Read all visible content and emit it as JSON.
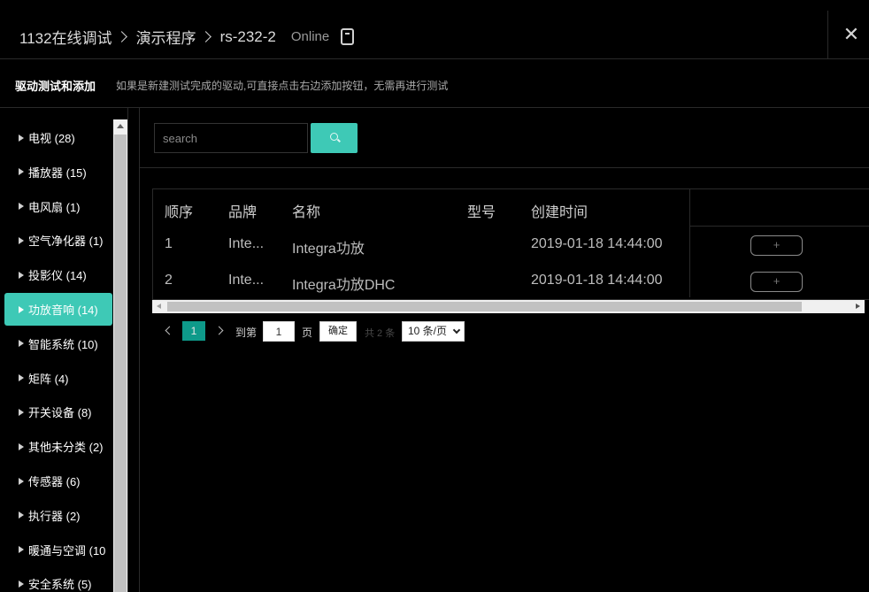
{
  "header": {
    "breadcrumb": [
      "1132在线调试",
      "演示程序",
      "rs-232-2"
    ],
    "status": "Online",
    "device_icon": "device-icon",
    "close_icon": "close-icon"
  },
  "subbar": {
    "title": "驱动测试和添加",
    "hint": "如果是新建测试完成的驱动,可直接点击右边添加按钮，无需再进行测试"
  },
  "sidebar": {
    "items": [
      {
        "label": "电视 (28)",
        "active": false
      },
      {
        "label": "播放器 (15)",
        "active": false
      },
      {
        "label": "电风扇 (1)",
        "active": false
      },
      {
        "label": "空气净化器 (1)",
        "active": false
      },
      {
        "label": "投影仪 (14)",
        "active": false
      },
      {
        "label": "功放音响 (14)",
        "active": true
      },
      {
        "label": "智能系统 (10)",
        "active": false
      },
      {
        "label": "矩阵 (4)",
        "active": false
      },
      {
        "label": "开关设备 (8)",
        "active": false
      },
      {
        "label": "其他未分类 (2)",
        "active": false
      },
      {
        "label": "传感器 (6)",
        "active": false
      },
      {
        "label": "执行器 (2)",
        "active": false
      },
      {
        "label": "暖通与空调 (10",
        "active": false
      },
      {
        "label": "安全系统 (5)",
        "active": false
      }
    ],
    "active_color": "#3ec9b6"
  },
  "search": {
    "placeholder": "search",
    "value": "",
    "button_icon": "search-icon"
  },
  "table": {
    "columns": [
      "顺序",
      "品牌",
      "名称",
      "型号",
      "创建时间"
    ],
    "rows": [
      {
        "order": "1",
        "brand": "Inte...",
        "name": "Integra功放",
        "model": "",
        "created": "2019-01-18 14:44:00",
        "action": "+"
      },
      {
        "order": "2",
        "brand": "Inte...",
        "name": "Integra功放DHC",
        "model": "",
        "created": "2019-01-18 14:44:00",
        "action": "+"
      }
    ]
  },
  "pager": {
    "current_page": "1",
    "goto_label": "到第",
    "goto_value": "1",
    "page_label": "页",
    "confirm_label": "确定",
    "total_label": "共 2 条",
    "page_size": "10 条/页",
    "accent_color": "#0e9a8a"
  }
}
